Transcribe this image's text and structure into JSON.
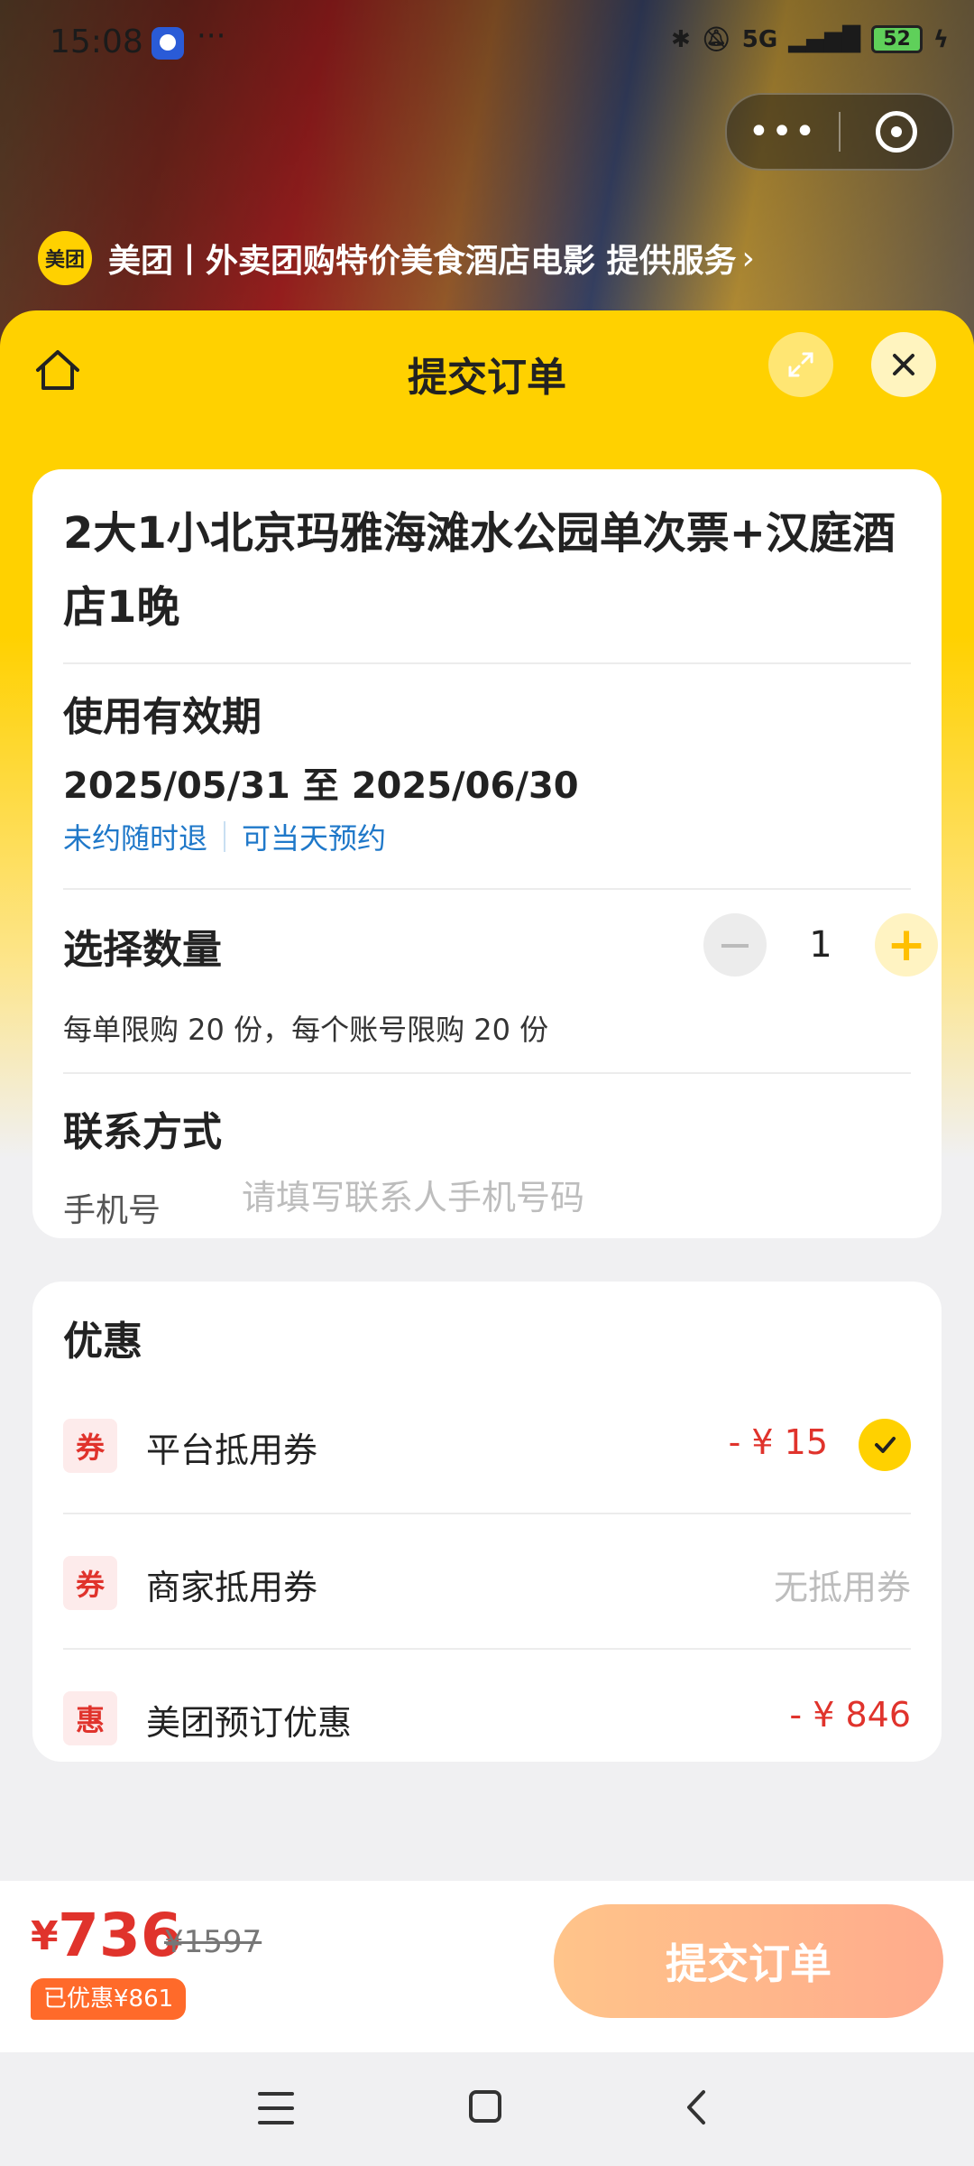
{
  "status_bar": {
    "time": "15:08",
    "dots": "···",
    "network": "5G",
    "battery": "52"
  },
  "provider": {
    "logo": "美团",
    "text": "美团丨外卖团购特价美食酒店电影 提供服务",
    "chevron": "›"
  },
  "header": {
    "title": "提交订单"
  },
  "product": {
    "name": "2大1小北京玛雅海滩水公园单次票+汉庭酒店1晚"
  },
  "validity": {
    "title": "使用有效期",
    "range": "2025/05/31 至 2025/06/30",
    "tag1": "未约随时退",
    "tag2": "可当天预约"
  },
  "quantity": {
    "title": "选择数量",
    "value": "1",
    "minus": "−",
    "plus": "+",
    "limit_text": "每单限购 20 份，每个账号限购 20 份"
  },
  "contact": {
    "title": "联系方式",
    "phone_label": "手机号",
    "phone_value": "",
    "phone_placeholder": "请填写联系人手机号码"
  },
  "discounts": {
    "title": "优惠",
    "items": [
      {
        "badge": "券",
        "label": "平台抵用券",
        "value": "- ¥ 15",
        "checked": true
      },
      {
        "badge": "券",
        "label": "商家抵用券",
        "value": "无抵用券"
      },
      {
        "badge": "惠",
        "label": "美团预订优惠",
        "value": "- ¥ 846"
      }
    ]
  },
  "footer": {
    "currency": "¥",
    "price": "736",
    "original_price": "¥1597",
    "saved": "已优惠¥861",
    "submit_label": "提交订单"
  },
  "colors": {
    "brand_yellow": "#ffd100",
    "price_red": "#e0332c",
    "link_blue": "#1f78c9"
  }
}
